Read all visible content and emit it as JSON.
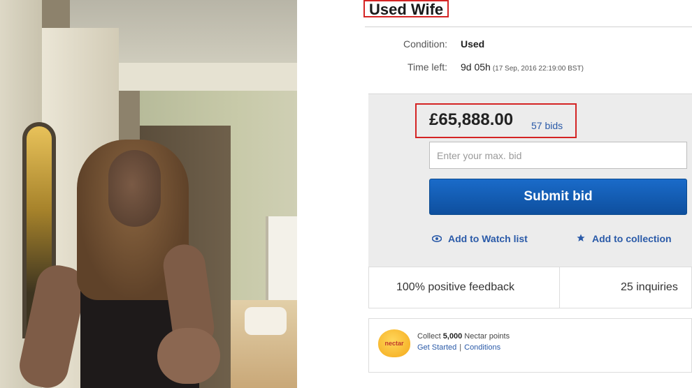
{
  "listing": {
    "title": "Used Wife",
    "condition_label": "Condition:",
    "condition_value": "Used",
    "time_left_label": "Time left:",
    "time_left_value": "9d 05h",
    "time_left_detail": "(17 Sep, 2016  22:19:00 BST)"
  },
  "bid": {
    "price": "£65,888.00",
    "bids_link": "57 bids",
    "input_placeholder": "Enter your max. bid",
    "submit_label": "Submit bid",
    "watch_label": "Add to Watch list",
    "collection_label": "Add to collection"
  },
  "stats": {
    "feedback": "100% positive feedback",
    "inquiries": "25 inquiries"
  },
  "nectar": {
    "logo_text": "nectar",
    "collect_prefix": "Collect",
    "points": "5,000",
    "collect_suffix": "Nectar points",
    "get_started": "Get Started",
    "separator": "|",
    "conditions": "Conditions"
  },
  "icons": {
    "watch": "eye-icon",
    "collection": "star-icon"
  },
  "colors": {
    "highlight_border": "#d42424",
    "link": "#2a5aa8",
    "submit_button": "#1a6bc9"
  }
}
